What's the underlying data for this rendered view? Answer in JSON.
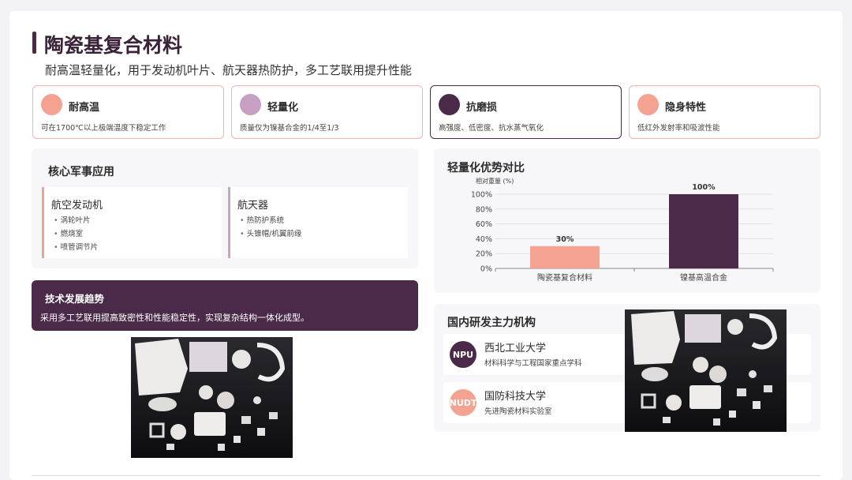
{
  "header": {
    "title": "陶瓷基复合材料",
    "subtitle": "耐高温轻量化，用于发动机叶片、航天器热防护，多工艺联用提升性能"
  },
  "features": [
    {
      "title": "耐高温",
      "desc": "可在1700℃以上极端温度下稳定工作",
      "color": "#f4a392"
    },
    {
      "title": "轻量化",
      "desc": "质量仅为镍基合金的1/4至1/3",
      "color": "#c6a0c3"
    },
    {
      "title": "抗磨损",
      "desc": "高强度、低密度、抗水蒸气氧化",
      "color": "#4a2a48"
    },
    {
      "title": "隐身特性",
      "desc": "低红外发射率和吸波性能",
      "color": "#f4a392"
    }
  ],
  "applications": {
    "title": "核心军事应用",
    "items": [
      {
        "title": "航空发动机",
        "points": [
          "涡轮叶片",
          "燃烧室",
          "喷管调节片"
        ]
      },
      {
        "title": "航天器",
        "points": [
          "热防护系统",
          "头锥帽/机翼前缘"
        ]
      }
    ]
  },
  "trend": {
    "title": "技术发展趋势",
    "desc": "采用多工艺联用提高致密性和性能稳定性，实现复杂结构一体化成型。"
  },
  "chart_data": {
    "type": "bar",
    "title": "轻量化优势对比",
    "ylabel": "相对重量 (%)",
    "categories": [
      "陶瓷基复合材料",
      "镍基高温合金"
    ],
    "values": [
      30,
      100
    ],
    "value_labels": [
      "30%",
      "100%"
    ],
    "colors": [
      "#f4a392",
      "#4a2a48"
    ],
    "ylim": [
      0,
      100
    ],
    "yticks": [
      "0%",
      "20%",
      "40%",
      "60%",
      "80%",
      "100%"
    ],
    "grid": true
  },
  "institutions": {
    "title": "国内研发主力机构",
    "items": [
      {
        "logo": "NPU",
        "name": "西北工业大学",
        "desc": "材料科学与工程国家重点学科",
        "color": "#4a2a48"
      },
      {
        "logo": "NUDT",
        "name": "国防科技大学",
        "desc": "先进陶瓷材料实验室",
        "color": "#f4a392"
      }
    ]
  }
}
